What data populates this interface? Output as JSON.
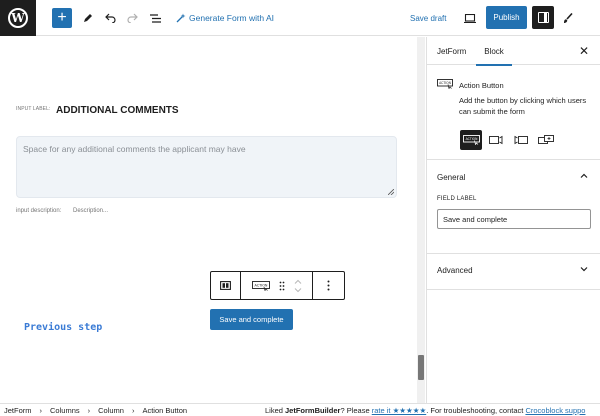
{
  "toolbar": {
    "generate_label": "Generate Form with AI",
    "save_draft_label": "Save draft",
    "publish_label": "Publish"
  },
  "canvas": {
    "input_label_caption": "INPUT LABEL:",
    "input_label_value": "ADDITIONAL COMMENTS",
    "textarea_placeholder": "Space for any additional comments the applicant may have",
    "description_caption": "input description:",
    "description_value": "Description...",
    "previous_step_label": "Previous step",
    "save_complete_label": "Save and complete"
  },
  "sidebar": {
    "tabs": [
      {
        "label": "JetForm"
      },
      {
        "label": "Block"
      }
    ],
    "active_tab": "Block",
    "block_title": "Action Button",
    "block_description": "Add the button by clicking which users can submit the form",
    "general_heading": "General",
    "field_label_caption": "FIELD LABEL",
    "field_label_value": "Save and complete",
    "advanced_heading": "Advanced"
  },
  "footer": {
    "breadcrumbs": [
      "JetForm",
      "Columns",
      "Column",
      "Action Button"
    ],
    "message_prefix": "Liked ",
    "message_brand": "JetFormBuilder",
    "message_mid": "? Please ",
    "rate_link": "rate it ★★★★★",
    "message_suffix": ". For troubleshooting, contact ",
    "support_link": "Crocoblock suppo"
  },
  "colors": {
    "accent": "#2271b1",
    "dark": "#1e1e1e",
    "field_bg": "#f0f4f8",
    "prev_step": "#3a7bd5"
  },
  "icons": [
    "wordpress-logo-icon",
    "plus-icon",
    "pen-icon",
    "undo-icon",
    "redo-icon",
    "list-view-icon",
    "ai-wand-icon",
    "desktop-preview-icon",
    "settings-sidebar-icon",
    "styles-brush-icon",
    "close-icon",
    "action-button-icon",
    "chevron-up-icon",
    "chevron-down-icon",
    "drag-handle-icon",
    "more-options-icon"
  ]
}
